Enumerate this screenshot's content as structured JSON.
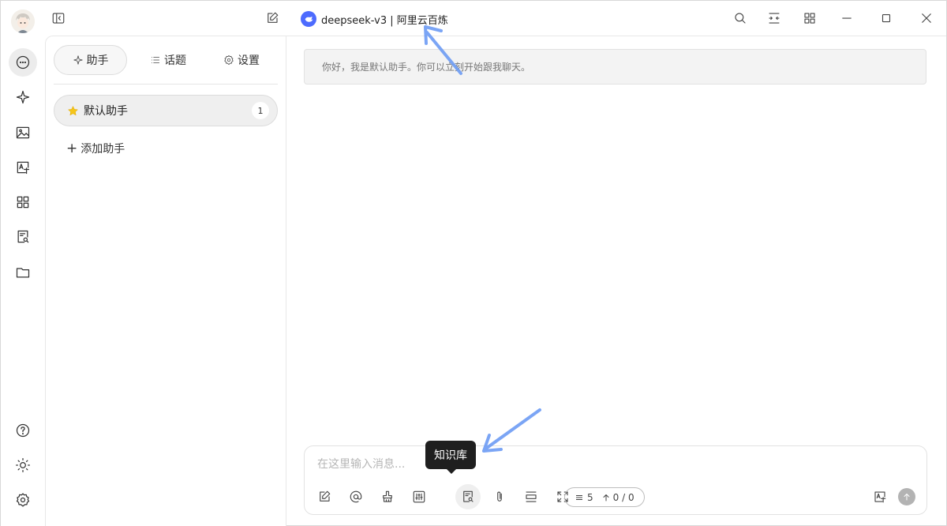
{
  "window": {
    "model_name": "deepseek-v3 | 阿里云百炼"
  },
  "icons": {
    "avatar": "user-avatar-icon",
    "chat": "chat-bubble-icon",
    "agents": "sparkle-icon",
    "paint": "image-icon",
    "translate": "translate-icon",
    "apps": "apps-grid-icon",
    "knowledge": "knowledge-base-icon",
    "files": "folder-icon",
    "help": "help-circle-icon",
    "theme": "sun-icon",
    "settings": "gear-icon"
  },
  "assistants_panel": {
    "tabs": [
      {
        "label": "助手",
        "icon": "sparkle-icon"
      },
      {
        "label": "话题",
        "icon": "list-icon"
      },
      {
        "label": "设置",
        "icon": "gear-icon"
      }
    ],
    "items": [
      {
        "name": "默认助手",
        "count": "1",
        "icon": "star-icon"
      }
    ],
    "add_label": "添加助手"
  },
  "chat": {
    "welcome_message": "你好，我是默认助手。你可以立刻开始跟我聊天。",
    "input_placeholder": "在这里输入消息...",
    "tooltip": "知识库",
    "context_count": "5",
    "token_count": "0 / 0"
  },
  "colors": {
    "brand": "#4d6bfe",
    "annotation_arrow": "#6d9cf4",
    "tooltip_bg": "#1f1f1f",
    "star": "#f5c518"
  }
}
